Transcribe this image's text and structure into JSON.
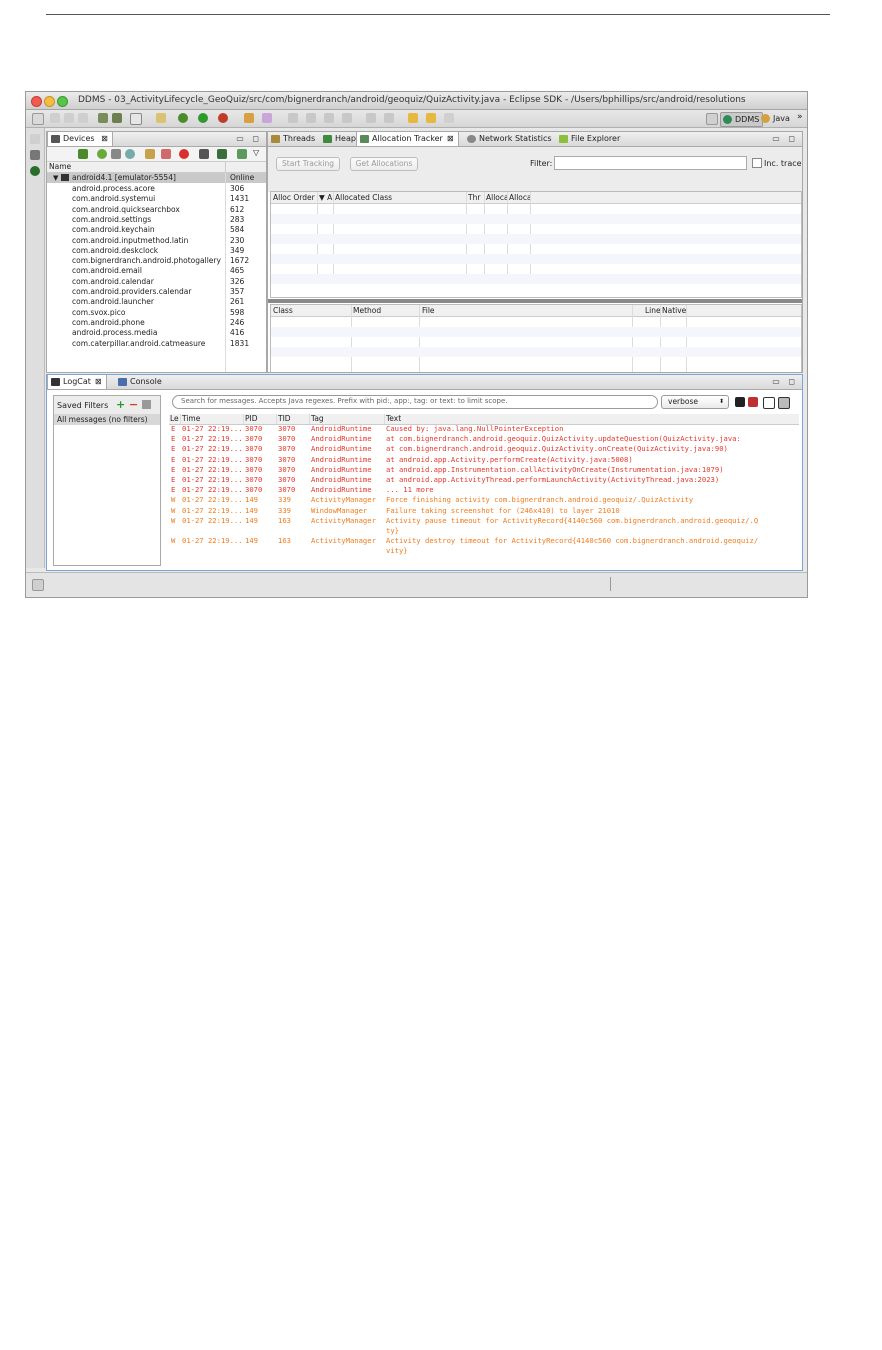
{
  "window": {
    "title": "DDMS - 03_ActivityLifecycle_GeoQuiz/src/com/bignerdranch/android/geoquiz/QuizActivity.java - Eclipse SDK - /Users/bphillips/src/android/resolutions"
  },
  "perspectives": [
    "DDMS",
    "Java"
  ],
  "devices": {
    "tab_label": "Devices",
    "col_name": "Name",
    "col_status": "",
    "device": {
      "name": "android4.1 [emulator-5554]",
      "status": "Online"
    },
    "processes": [
      {
        "name": "android.process.acore",
        "pid": "306"
      },
      {
        "name": "com.android.systemui",
        "pid": "1431"
      },
      {
        "name": "com.android.quicksearchbox",
        "pid": "612"
      },
      {
        "name": "com.android.settings",
        "pid": "283"
      },
      {
        "name": "com.android.keychain",
        "pid": "584"
      },
      {
        "name": "com.android.inputmethod.latin",
        "pid": "230"
      },
      {
        "name": "com.android.deskclock",
        "pid": "349"
      },
      {
        "name": "com.bignerdranch.android.photogallery",
        "pid": "1672"
      },
      {
        "name": "com.android.email",
        "pid": "465"
      },
      {
        "name": "com.android.calendar",
        "pid": "326"
      },
      {
        "name": "com.android.providers.calendar",
        "pid": "357"
      },
      {
        "name": "com.android.launcher",
        "pid": "261"
      },
      {
        "name": "com.svox.pico",
        "pid": "598"
      },
      {
        "name": "com.android.phone",
        "pid": "246"
      },
      {
        "name": "android.process.media",
        "pid": "416"
      },
      {
        "name": "com.caterpillar.android.catmeasure",
        "pid": "1831"
      }
    ]
  },
  "alloc_tabs": [
    "Threads",
    "Heap",
    "Allocation Tracker",
    "Network Statistics",
    "File Explorer"
  ],
  "alloc": {
    "start_tracking": "Start Tracking",
    "get_allocations": "Get Allocations",
    "filter_label": "Filter:",
    "filter_value": "",
    "inc_trace": "Inc. trace",
    "columns_top": [
      "Alloc Order",
      "▼ A",
      "Allocated Class",
      "Thr",
      "Alloca",
      "Alloca"
    ],
    "columns_bottom": [
      "Class",
      "Method",
      "File",
      "Line",
      "Native"
    ]
  },
  "logcat": {
    "tab_label": "LogCat",
    "console_label": "Console",
    "saved_filters": "Saved Filters",
    "all_messages": "All messages (no filters)",
    "search_placeholder": "Search for messages. Accepts Java regexes. Prefix with pid:, app:, tag: or text: to limit scope.",
    "level_select": "verbose",
    "columns": [
      "Le",
      "Time",
      "PID",
      "TID",
      "Tag",
      "Text"
    ],
    "rows": [
      {
        "level": "E",
        "time": "01-27 22:19...",
        "pid": "3070",
        "tid": "3070",
        "tag": "AndroidRuntime",
        "text": "Caused by: java.lang.NullPointerException",
        "color": "#e3372c"
      },
      {
        "level": "E",
        "time": "01-27 22:19...",
        "pid": "3070",
        "tid": "3070",
        "tag": "AndroidRuntime",
        "text": "    at com.bignerdranch.android.geoquiz.QuizActivity.updateQuestion(QuizActivity.java:",
        "color": "#e3372c"
      },
      {
        "level": "E",
        "time": "01-27 22:19...",
        "pid": "3070",
        "tid": "3070",
        "tag": "AndroidRuntime",
        "text": "    at com.bignerdranch.android.geoquiz.QuizActivity.onCreate(QuizActivity.java:90)",
        "color": "#e3372c"
      },
      {
        "level": "E",
        "time": "01-27 22:19...",
        "pid": "3070",
        "tid": "3070",
        "tag": "AndroidRuntime",
        "text": "    at android.app.Activity.performCreate(Activity.java:5008)",
        "color": "#e3372c"
      },
      {
        "level": "E",
        "time": "01-27 22:19...",
        "pid": "3070",
        "tid": "3070",
        "tag": "AndroidRuntime",
        "text": "    at android.app.Instrumentation.callActivityOnCreate(Instrumentation.java:1079)",
        "color": "#e3372c"
      },
      {
        "level": "E",
        "time": "01-27 22:19...",
        "pid": "3070",
        "tid": "3070",
        "tag": "AndroidRuntime",
        "text": "    at android.app.ActivityThread.performLaunchActivity(ActivityThread.java:2023)",
        "color": "#e3372c"
      },
      {
        "level": "E",
        "time": "01-27 22:19...",
        "pid": "3070",
        "tid": "3070",
        "tag": "AndroidRuntime",
        "text": "    ... 11 more",
        "color": "#e3372c"
      },
      {
        "level": "W",
        "time": "01-27 22:19...",
        "pid": "149",
        "tid": "339",
        "tag": "ActivityManager",
        "text": "  Force finishing activity com.bignerdranch.android.geoquiz/.QuizActivity",
        "color": "#ef7b1d"
      },
      {
        "level": "W",
        "time": "01-27 22:19...",
        "pid": "149",
        "tid": "339",
        "tag": "WindowManager",
        "text": "Failure taking screenshot for (246x410) to layer 21010",
        "color": "#ef7b1d"
      },
      {
        "level": "W",
        "time": "01-27 22:19...",
        "pid": "149",
        "tid": "163",
        "tag": "ActivityManager",
        "text": "Activity pause timeout for ActivityRecord{4140c560 com.bignerdranch.android.geoquiz/.Q",
        "color": "#ef7b1d"
      },
      {
        "level": "",
        "time": "",
        "pid": "",
        "tid": "",
        "tag": "",
        "text": "ty}",
        "color": "#ef7b1d"
      },
      {
        "level": "W",
        "time": "01-27 22:19...",
        "pid": "149",
        "tid": "163",
        "tag": "ActivityManager",
        "text": "Activity destroy timeout for ActivityRecord{4140c560 com.bignerdranch.android.geoquiz/",
        "color": "#ef7b1d"
      },
      {
        "level": "",
        "time": "",
        "pid": "",
        "tid": "",
        "tag": "",
        "text": "vity}",
        "color": "#ef7b1d"
      }
    ]
  }
}
